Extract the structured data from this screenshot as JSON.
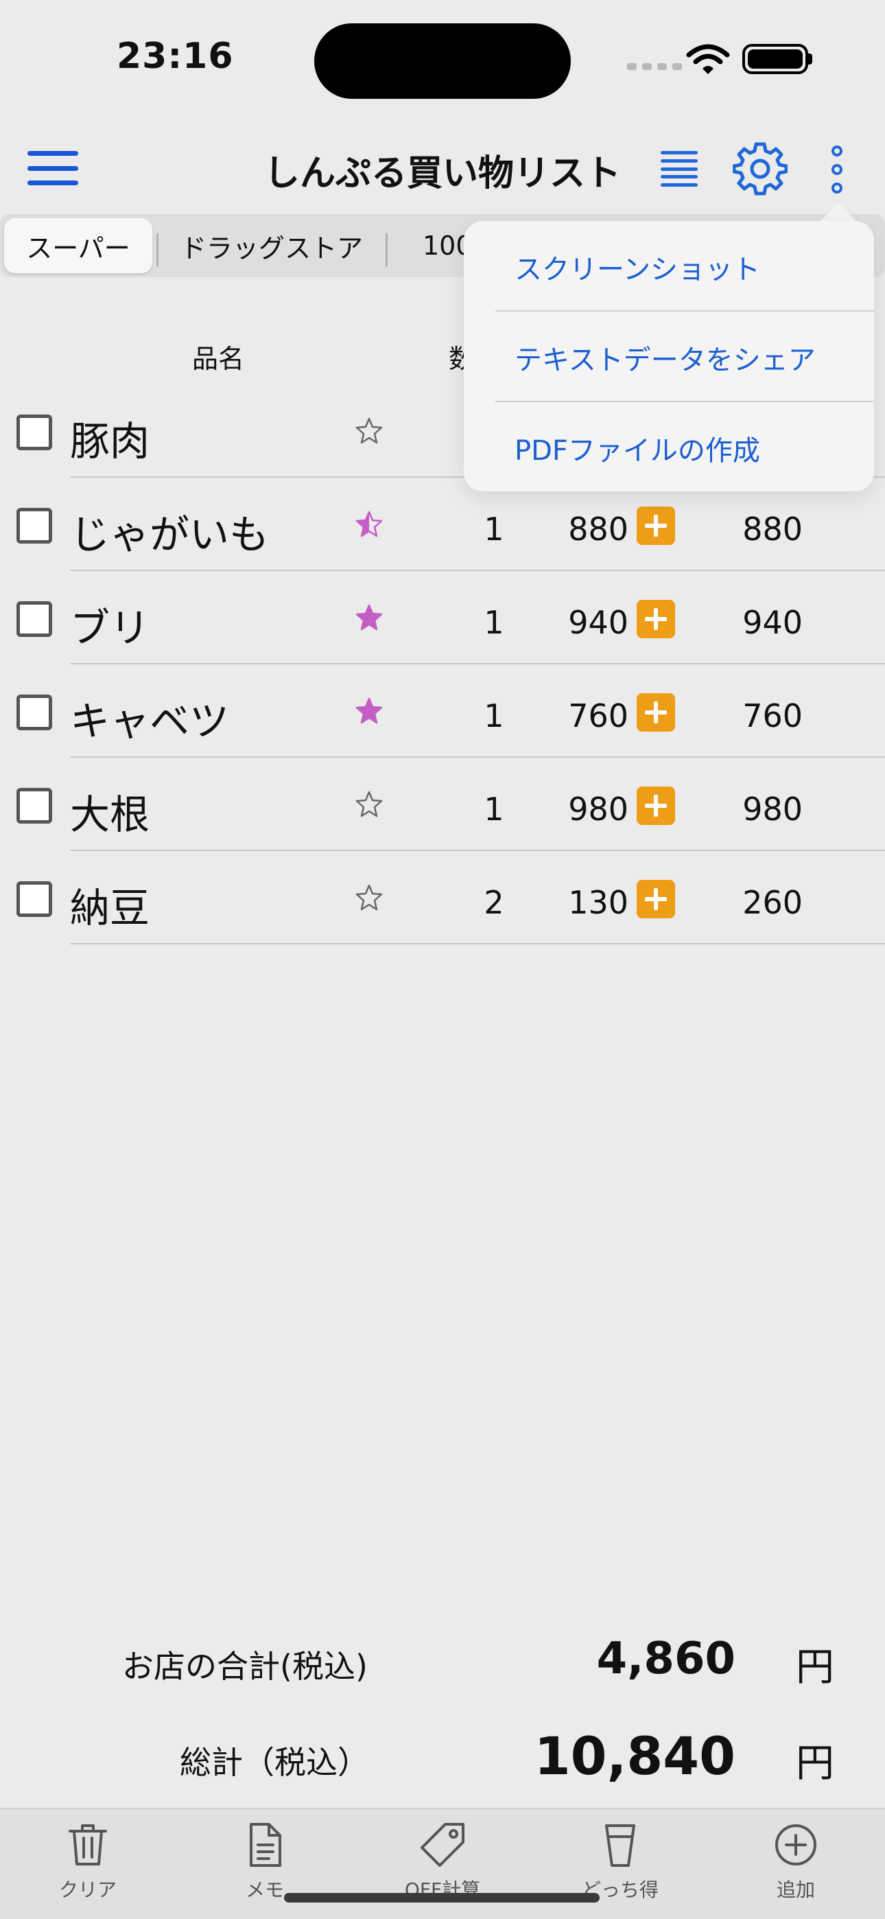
{
  "status_bar": {
    "time": "23:16"
  },
  "header": {
    "title": "しんぷる買い物リスト"
  },
  "tabs": [
    {
      "label": "スーパー",
      "active": true
    },
    {
      "label": "ドラッグストア",
      "active": false
    },
    {
      "label": "100",
      "active": false
    }
  ],
  "columns": {
    "name": "品名",
    "qty": "数"
  },
  "items": [
    {
      "name": "豚肉",
      "star": "empty",
      "qty": "",
      "price": "",
      "subtotal": ""
    },
    {
      "name": "じゃがいも",
      "star": "half",
      "qty": "1",
      "price": "880",
      "subtotal": "880"
    },
    {
      "name": "ブリ",
      "star": "full",
      "qty": "1",
      "price": "940",
      "subtotal": "940"
    },
    {
      "name": "キャベツ",
      "star": "full",
      "qty": "1",
      "price": "760",
      "subtotal": "760"
    },
    {
      "name": "大根",
      "star": "empty",
      "qty": "1",
      "price": "980",
      "subtotal": "980"
    },
    {
      "name": "納豆",
      "star": "empty",
      "qty": "2",
      "price": "130",
      "subtotal": "260"
    }
  ],
  "dropdown": {
    "items": [
      {
        "label": "スクリーンショット"
      },
      {
        "label": "テキストデータをシェア"
      },
      {
        "label": "PDFファイルの作成"
      }
    ]
  },
  "totals": {
    "store_label": "お店の合計(税込)",
    "store_value": "4,860",
    "grand_label": "総計（税込）",
    "grand_value": "10,840",
    "currency": "円"
  },
  "tabbar": {
    "items": [
      {
        "label": "クリア",
        "icon": "trash-icon"
      },
      {
        "label": "メモ",
        "icon": "document-icon"
      },
      {
        "label": "OFF計算",
        "icon": "tag-icon"
      },
      {
        "label": "どっち得",
        "icon": "cup-icon"
      },
      {
        "label": "追加",
        "icon": "plus-circle-icon"
      }
    ]
  },
  "colors": {
    "accent": "#1f68d6",
    "plus_button": "#ee9d17",
    "star_filled": "#c45dc4",
    "menu_text": "#1c5fcf"
  }
}
